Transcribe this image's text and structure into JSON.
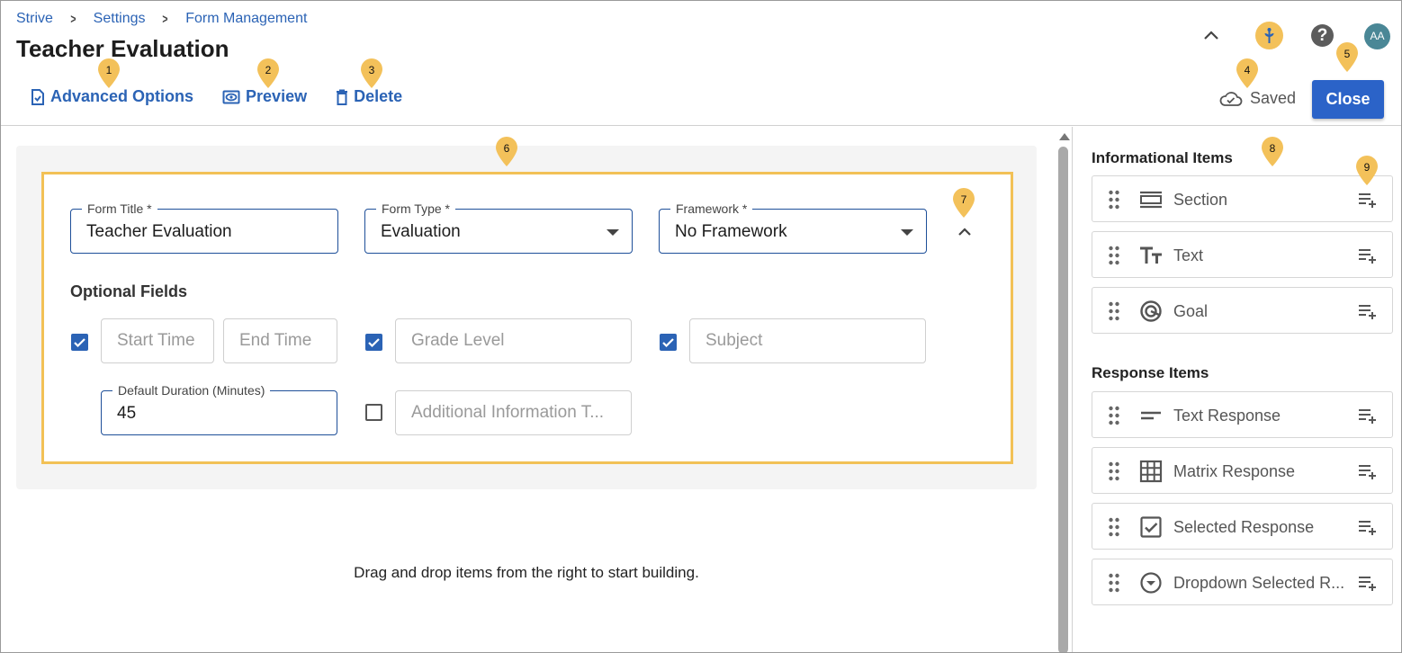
{
  "breadcrumb": [
    "Strive",
    "Settings",
    "Form Management"
  ],
  "page_title": "Teacher Evaluation",
  "toolbar": {
    "advanced_options": "Advanced Options",
    "preview": "Preview",
    "delete": "Delete"
  },
  "header": {
    "avatar_initials": "AA",
    "help_glyph": "?",
    "saved_label": "Saved",
    "close_label": "Close"
  },
  "markers": [
    "1",
    "2",
    "3",
    "4",
    "5",
    "6",
    "7",
    "8",
    "9"
  ],
  "form": {
    "form_title_label": "Form Title *",
    "form_title_value": "Teacher Evaluation",
    "form_type_label": "Form Type *",
    "form_type_value": "Evaluation",
    "framework_label": "Framework *",
    "framework_value": "No Framework",
    "optional_fields_title": "Optional Fields",
    "start_time": "Start Time",
    "end_time": "End Time",
    "grade_level": "Grade Level",
    "subject": "Subject",
    "default_duration_label": "Default Duration (Minutes)",
    "default_duration_value": "45",
    "additional_info": "Additional Information T..."
  },
  "empty_message": "Drag and drop items from the right to start building.",
  "right_panel": {
    "informational_heading": "Informational Items",
    "informational_items": [
      "Section",
      "Text",
      "Goal"
    ],
    "response_heading": "Response Items",
    "response_items": [
      "Text Response",
      "Matrix Response",
      "Selected Response",
      "Dropdown Selected R..."
    ]
  },
  "colors": {
    "accent": "#2b63b5",
    "highlight": "#f2c156",
    "marker": "#f3c15a"
  },
  "icons": {
    "advanced_options": "file-check-icon",
    "preview": "eye-icon",
    "delete": "trash-icon",
    "saved": "cloud-check-icon",
    "section": "section-icon",
    "text": "text-format-icon",
    "goal": "target-icon",
    "text_response": "short-text-icon",
    "matrix_response": "grid-icon",
    "selected_response": "checkbox-icon",
    "dropdown_response": "dropdown-circle-icon",
    "add": "playlist-add-icon",
    "drag": "drag-handle-icon"
  }
}
